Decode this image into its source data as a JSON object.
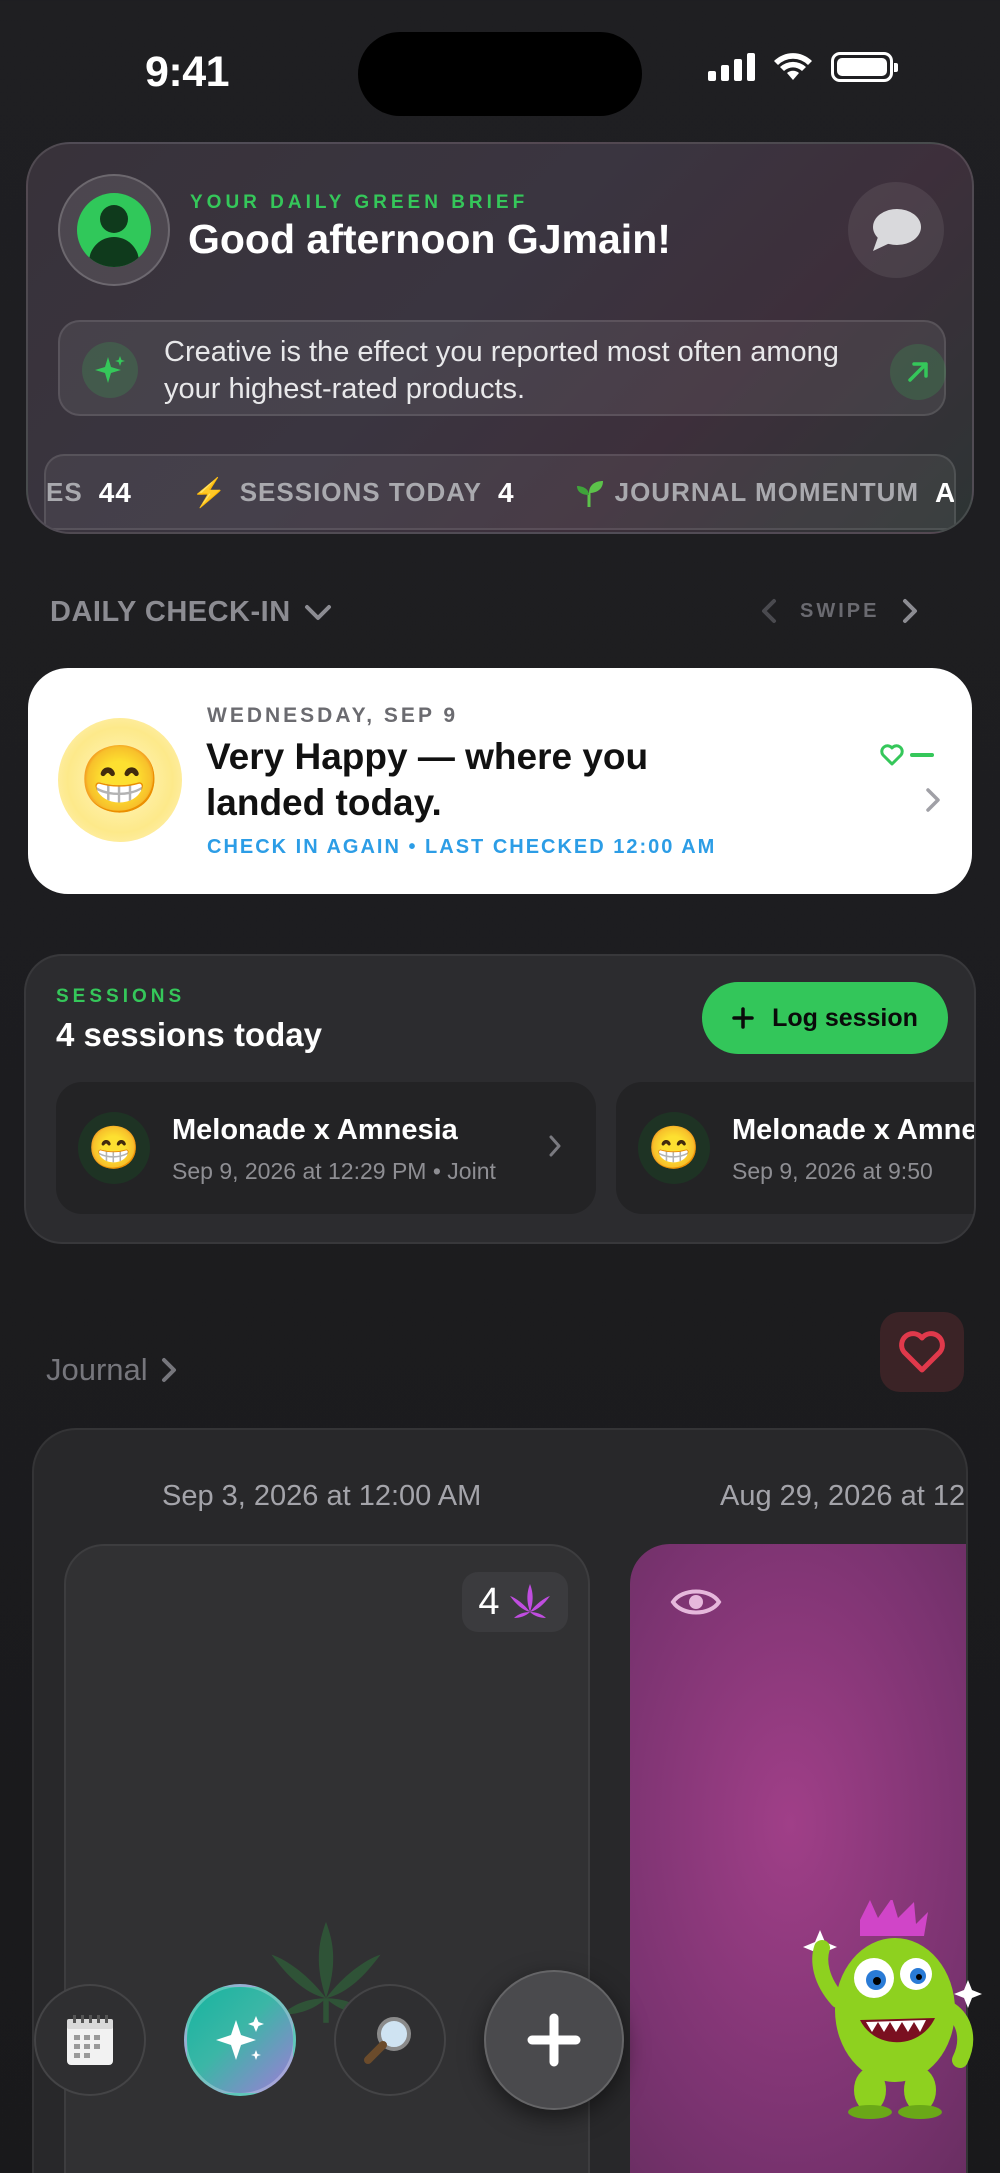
{
  "status_bar": {
    "time": "9:41"
  },
  "brief": {
    "kicker": "YOUR DAILY GREEN BRIEF",
    "greeting": "Good afternoon GJmain!",
    "insight": "Creative is the effect you reported most often among your highest-rated products.",
    "ticker": [
      {
        "label": "ES",
        "value": "44",
        "icon": "none"
      },
      {
        "label": "SESSIONS TODAY",
        "value": "4",
        "icon": "lightning-icon"
      },
      {
        "label": "JOURNAL MOMENTUM",
        "value": "AC",
        "icon": "sprout-icon"
      }
    ]
  },
  "daily_checkin": {
    "section_label": "DAILY CHECK-IN",
    "swipe_label": "SWIPE",
    "date": "WEDNESDAY, SEP 9",
    "emoji": "😁",
    "title": "Very Happy — where you landed today.",
    "subtitle": "CHECK IN AGAIN • LAST CHECKED 12:00 AM"
  },
  "sessions": {
    "kicker": "SESSIONS",
    "title": "4 sessions today",
    "log_button": "Log session",
    "items": [
      {
        "emoji": "😁",
        "name": "Melonade x Amnesia",
        "meta": "Sep 9, 2026 at 12:29 PM • Joint"
      },
      {
        "emoji": "😁",
        "name": "Melonade x Amnesia",
        "meta": "Sep 9, 2026 at 9:50"
      }
    ]
  },
  "journal": {
    "label": "Journal",
    "entries": [
      {
        "date": "Sep 3, 2026 at 12:00 AM",
        "badge_count": "4"
      },
      {
        "date": "Aug 29, 2026 at 12"
      }
    ]
  },
  "colors": {
    "accent_green": "#35c75a",
    "link_blue": "#2c9de6",
    "journal_purple": "#a03f88",
    "favorite_red": "#e0394b"
  }
}
